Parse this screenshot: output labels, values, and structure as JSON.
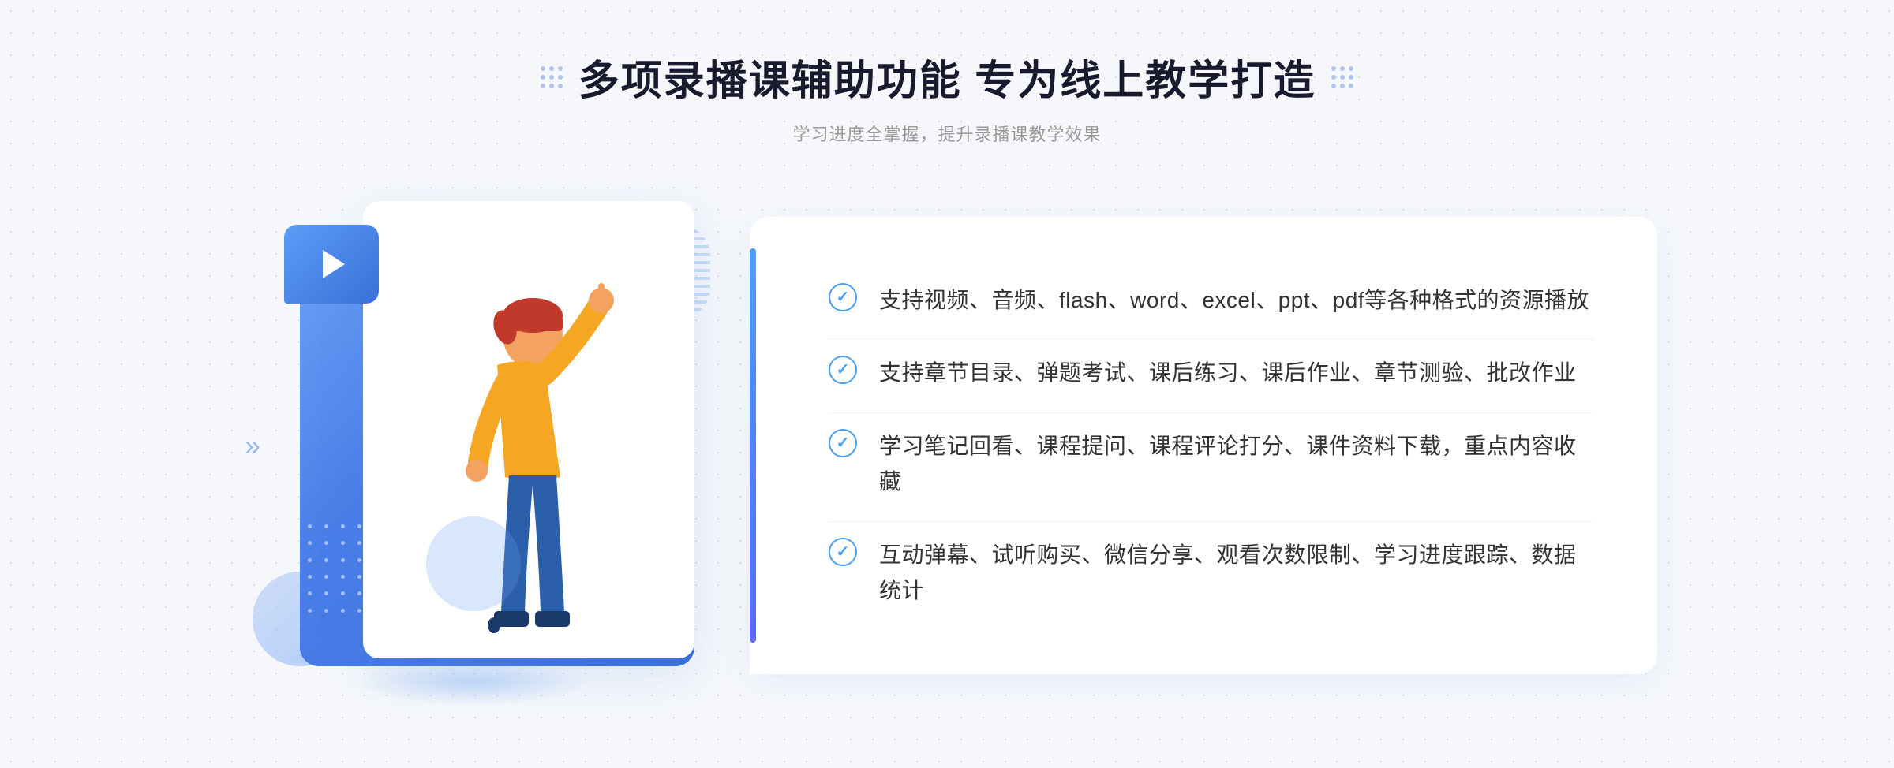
{
  "header": {
    "title": "多项录播课辅助功能 专为线上教学打造",
    "subtitle": "学习进度全掌握，提升录播课教学效果",
    "dots_left": true,
    "dots_right": true
  },
  "features": [
    {
      "id": 1,
      "text": "支持视频、音频、flash、word、excel、ppt、pdf等各种格式的资源播放"
    },
    {
      "id": 2,
      "text": "支持章节目录、弹题考试、课后练习、课后作业、章节测验、批改作业"
    },
    {
      "id": 3,
      "text": "学习笔记回看、课程提问、课程评论打分、课件资料下载，重点内容收藏"
    },
    {
      "id": 4,
      "text": "互动弹幕、试听购买、微信分享、观看次数限制、学习进度跟踪、数据统计"
    }
  ],
  "illustration": {
    "play_label": "▶"
  },
  "colors": {
    "primary_blue": "#4a7ee8",
    "light_blue": "#6fa3f7",
    "text_dark": "#1a1a2e",
    "text_gray": "#999999",
    "text_body": "#333333"
  }
}
